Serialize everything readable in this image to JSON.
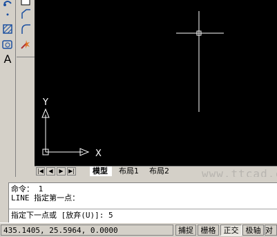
{
  "drawing": {
    "ucs_x_label": "X",
    "ucs_y_label": "Y",
    "background": "#000000"
  },
  "layout_tabs": [
    "模型",
    "布局1",
    "布局2"
  ],
  "nav_buttons": [
    "|◀",
    "◀",
    "▶",
    "▶|"
  ],
  "command_window": {
    "history": [
      "命令： 1",
      "LINE 指定第一点："
    ],
    "prompt": "指定下一点或 [放弃(U)]: 5"
  },
  "status_bar": {
    "coordinates": "435.1405, 25.5964, 0.0000",
    "buttons": [
      "捕捉",
      "栅格",
      "正交",
      "极轴",
      "对象"
    ]
  },
  "watermark": "www.ttcad.com",
  "tools": {
    "left": [
      "move-icon",
      "point-icon",
      "hatch-icon",
      "region-icon",
      "multiline-text-icon"
    ],
    "left_text_tool": "A",
    "right": [
      "box-icon",
      "chamfer-icon",
      "fillet-icon",
      "explode-icon"
    ]
  }
}
